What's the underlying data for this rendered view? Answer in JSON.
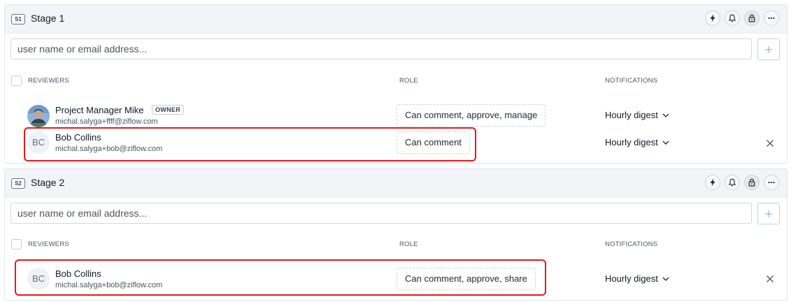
{
  "stages": [
    {
      "badge": "S1",
      "title": "Stage 1",
      "search_placeholder": "user name or email address...",
      "columns": {
        "reviewers": "REVIEWERS",
        "role": "ROLE",
        "notifications": "NOTIFICATIONS"
      },
      "reviewers": [
        {
          "name": "Project Manager Mike",
          "badge": "OWNER",
          "email": "michal.salyga+ffff@ziflow.com",
          "role": "Can comment, approve, manage",
          "notifications": "Hourly digest"
        },
        {
          "initials": "BC",
          "name": "Bob Collins",
          "email": "michal.salyga+bob@ziflow.com",
          "role": "Can comment",
          "notifications": "Hourly digest"
        }
      ]
    },
    {
      "badge": "S2",
      "title": "Stage 2",
      "search_placeholder": "user name or email address...",
      "columns": {
        "reviewers": "REVIEWERS",
        "role": "ROLE",
        "notifications": "NOTIFICATIONS"
      },
      "reviewers": [
        {
          "initials": "BC",
          "name": "Bob Collins",
          "email": "michal.salyga+bob@ziflow.com",
          "role": "Can comment, approve, share",
          "notifications": "Hourly digest"
        }
      ]
    }
  ],
  "stage_action_icons": [
    "lightning-icon",
    "bell-icon",
    "lock-icon",
    "more-icon"
  ],
  "colors": {
    "highlight": "#e01b1b",
    "header_bg": "#f3f4f7",
    "add_button_border": "#b7d3e8"
  }
}
